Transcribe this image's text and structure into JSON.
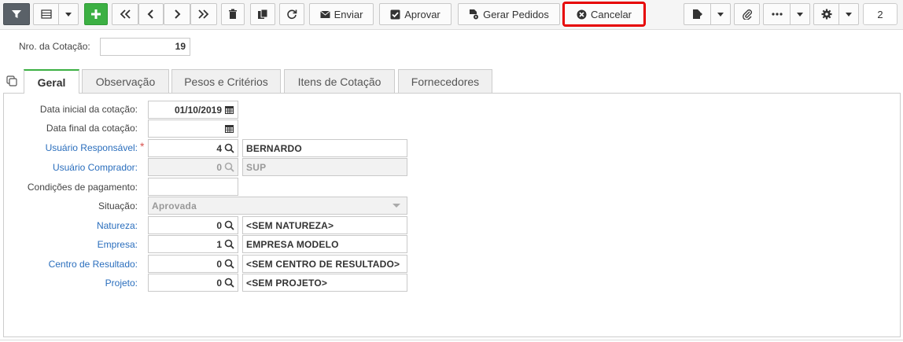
{
  "toolbar": {
    "enviar_label": "Enviar",
    "aprovar_label": "Aprovar",
    "gerar_pedidos_label": "Gerar Pedidos",
    "cancelar_label": "Cancelar",
    "page_number": "2",
    "highlight_color": "#e60000",
    "add_color": "#3cb043",
    "filter_color": "#5a6168"
  },
  "header": {
    "nro_label": "Nro. da Cotação:",
    "nro_value": "19"
  },
  "tabs": [
    {
      "label": "Geral",
      "active": true
    },
    {
      "label": "Observação"
    },
    {
      "label": "Pesos e Critérios"
    },
    {
      "label": "Itens de Cotação"
    },
    {
      "label": "Fornecedores"
    }
  ],
  "form": {
    "data_inicial_label": "Data inicial da cotação:",
    "data_inicial_value": "01/10/2019",
    "data_final_label": "Data final da cotação:",
    "data_final_value": "",
    "usuario_resp_label": "Usuário Responsável:",
    "usuario_resp_code": "4",
    "usuario_resp_name": "BERNARDO",
    "usuario_comp_label": "Usuário Comprador:",
    "usuario_comp_code": "0",
    "usuario_comp_name": "SUP",
    "cond_pag_label": "Condições de pagamento:",
    "cond_pag_value": "",
    "situacao_label": "Situação:",
    "situacao_value": "Aprovada",
    "natureza_label": "Natureza:",
    "natureza_code": "0",
    "natureza_name": "<SEM NATUREZA>",
    "empresa_label": "Empresa:",
    "empresa_code": "1",
    "empresa_name": "EMPRESA MODELO",
    "centro_label": "Centro de Resultado:",
    "centro_code": "0",
    "centro_name": "<SEM CENTRO DE RESULTADO>",
    "projeto_label": "Projeto:",
    "projeto_code": "0",
    "projeto_name": "<SEM PROJETO>"
  }
}
